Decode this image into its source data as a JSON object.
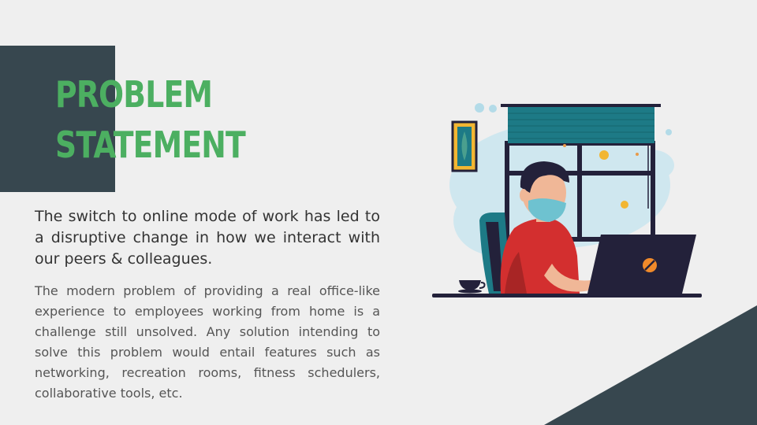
{
  "title": {
    "line1": "PROBLEM",
    "line2": "STATEMENT"
  },
  "lead_text": "The switch to online mode of work has led to a disruptive change in how we interact with our peers & colleagues.",
  "body_text": "The modern problem of providing a real office-like experience to employees working from home is a challenge still unsolved. Any solution intending to solve this problem would entail features such as networking, recreation rooms, fitness schedulers, collaborative tools, etc.",
  "illustration": {
    "icon": "person-working-on-laptop-illustration"
  },
  "colors": {
    "background": "#efefef",
    "dark_slate": "#37474f",
    "accent_green": "#4caf61",
    "shirt_red": "#d32f2f",
    "laptop_navy": "#23213a"
  }
}
